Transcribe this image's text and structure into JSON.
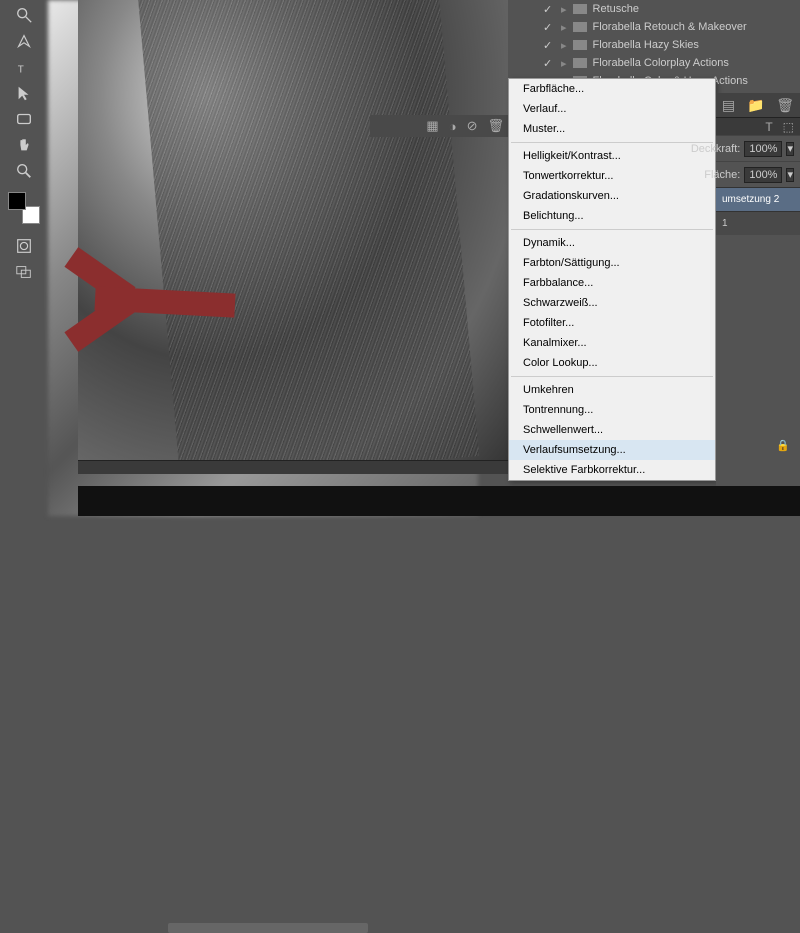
{
  "actions": {
    "items": [
      {
        "label": "Retusche"
      },
      {
        "label": "Florabella Retouch & Makeover"
      },
      {
        "label": "Florabella Hazy Skies"
      },
      {
        "label": "Florabella Colorplay Actions"
      },
      {
        "label": "Florabella Color & Haze Actions"
      }
    ]
  },
  "context_menu": {
    "group1": [
      "Farbfläche...",
      "Verlauf...",
      "Muster..."
    ],
    "group2": [
      "Helligkeit/Kontrast...",
      "Tonwertkorrektur...",
      "Gradationskurven...",
      "Belichtung..."
    ],
    "group3": [
      "Dynamik...",
      "Farbton/Sättigung...",
      "Farbbalance...",
      "Schwarzweiß...",
      "Fotofilter...",
      "Kanalmixer...",
      "Color Lookup..."
    ],
    "group4": [
      "Umkehren",
      "Tontrennung...",
      "Schwellenwert...",
      "Verlaufsumsetzung...",
      "Selektive Farbkorrektur..."
    ],
    "highlighted": "Verlaufsumsetzung..."
  },
  "layers_panel": {
    "opacity_label": "Deckkraft:",
    "opacity_value": "100%",
    "fill_label": "Fläche:",
    "fill_value": "100%",
    "layer1": "umsetzung 2",
    "layer2": "1"
  }
}
